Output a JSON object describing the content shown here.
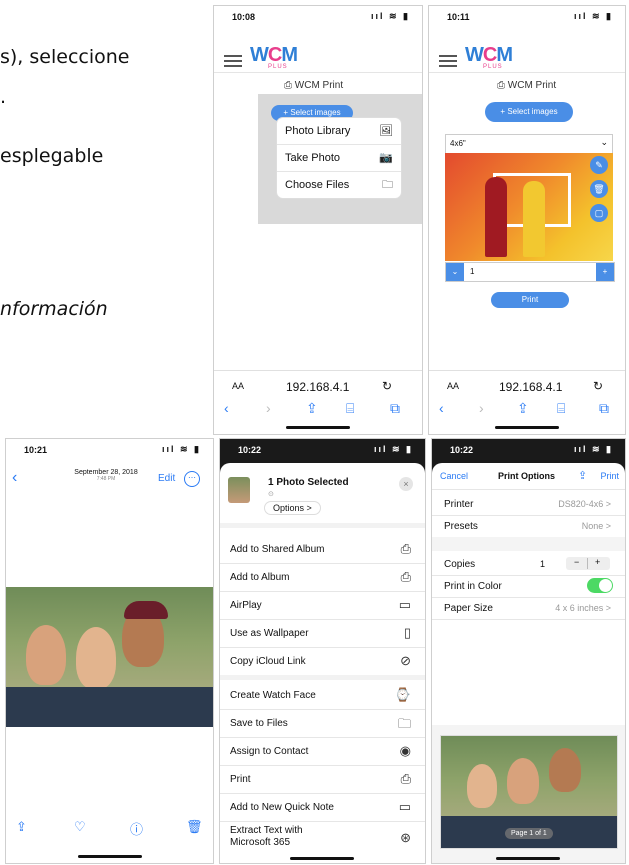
{
  "doc": {
    "line1": "s), seleccione",
    "line2": ".",
    "line3": "esplegable",
    "line4": "nformación"
  },
  "colors": {
    "accent": "#4a8ee6",
    "ios_blue": "#2b7bf4",
    "toggle_green": "#4cd964"
  },
  "p1": {
    "time": "10:08",
    "wcm_print": "WCM Print",
    "select_images": "+ Select images",
    "menu": [
      {
        "label": "Photo Library",
        "icon": "photo-library-icon",
        "glyph": "🖼"
      },
      {
        "label": "Take Photo",
        "icon": "camera-icon",
        "glyph": "📷"
      },
      {
        "label": "Choose Files",
        "icon": "folder-icon",
        "glyph": "🗀"
      }
    ],
    "aa": "AA",
    "url": "192.168.4.1"
  },
  "p2": {
    "time": "10:11",
    "wcm_print": "WCM Print",
    "select_images": "+ Select images",
    "size": "4x6\"",
    "field": "1",
    "print": "Print",
    "aa": "AA",
    "url": "192.168.4.1"
  },
  "p3": {
    "time": "10:21",
    "date": "September 28, 2018",
    "date_sub": "7:48 PM",
    "edit": "Edit"
  },
  "p4": {
    "time": "10:22",
    "selected": "1 Photo Selected",
    "options": "Options >",
    "rows": [
      {
        "label": "Add to Shared Album",
        "icon": "shared-album-icon",
        "glyph": "⎙"
      },
      {
        "label": "Add to Album",
        "icon": "album-icon",
        "glyph": "⎙"
      },
      {
        "label": "AirPlay",
        "icon": "airplay-icon",
        "glyph": "▭"
      },
      {
        "label": "Use as Wallpaper",
        "icon": "wallpaper-icon",
        "glyph": "▯"
      },
      {
        "label": "Copy iCloud Link",
        "icon": "link-icon",
        "glyph": "⊘"
      },
      {
        "label": "Create Watch Face",
        "icon": "watch-icon",
        "glyph": "⌚"
      },
      {
        "label": "Save to Files",
        "icon": "folder-icon",
        "glyph": "🗀"
      },
      {
        "label": "Assign to Contact",
        "icon": "contact-icon",
        "glyph": "◉"
      },
      {
        "label": "Print",
        "icon": "printer-icon",
        "glyph": "⎙"
      },
      {
        "label": "Add to New Quick Note",
        "icon": "quick-note-icon",
        "glyph": "▭"
      },
      {
        "label": "Extract Text with",
        "label2": "Microsoft 365",
        "icon": "microsoft-365-icon",
        "glyph": "⊛"
      }
    ]
  },
  "p5": {
    "time": "10:22",
    "cancel": "Cancel",
    "title": "Print Options",
    "print": "Print",
    "printer_label": "Printer",
    "printer_value": "DS820-4x6 >",
    "presets_label": "Presets",
    "presets_value": "None >",
    "copies_label": "Copies",
    "copies_value": "1",
    "color_label": "Print in Color",
    "paper_label": "Paper Size",
    "paper_value": "4 x 6 inches >",
    "page": "Page 1 of 1"
  }
}
